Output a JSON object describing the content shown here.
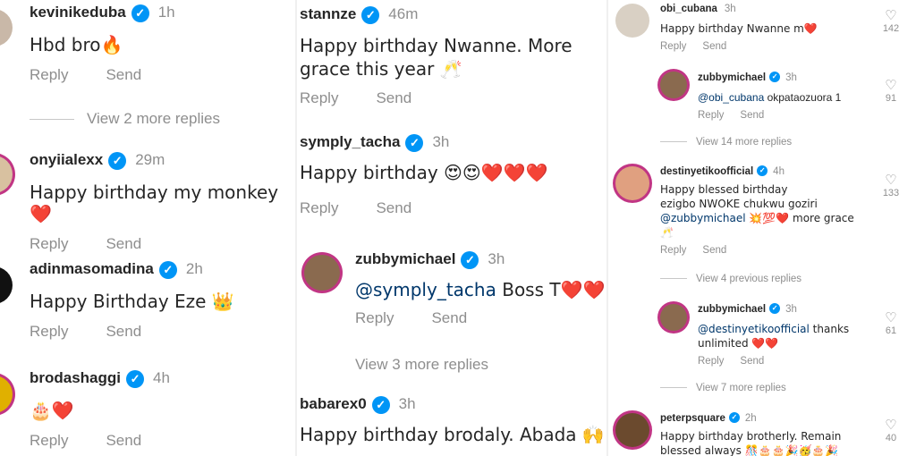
{
  "actions": {
    "reply": "Reply",
    "send": "Send"
  },
  "verified_glyph": "✓",
  "heart_glyph": "♡",
  "col1": {
    "comments": [
      {
        "username": "kevinikeduba",
        "time": "1h",
        "text": "Hbd bro🔥"
      },
      {
        "username": "onyiialexx",
        "time": "29m",
        "text": "Happy birthday my monkey ❤️"
      },
      {
        "username": "adinmasomadina",
        "time": "2h",
        "text": "Happy Birthday Eze 👑"
      },
      {
        "username": "brodashaggi",
        "time": "4h",
        "text": "🎂❤️"
      }
    ],
    "view_replies": "View 2 more replies"
  },
  "col2": {
    "comments": [
      {
        "username": "stannze",
        "time": "46m",
        "text": "Happy birthday Nwanne. More grace this year 🥂"
      },
      {
        "username": "symply_tacha",
        "time": "3h",
        "text": "Happy birthday 😍😍❤️❤️❤️"
      },
      {
        "username": "zubbymichael",
        "time": "3h",
        "mention": "@symply_tacha",
        "text": " Boss T❤️❤️"
      },
      {
        "username": "babarex0",
        "time": "3h",
        "text": "Happy birthday brodaly.  Abada 🙌"
      }
    ],
    "view_replies": "View 3 more replies"
  },
  "col3": {
    "comments": [
      {
        "username": "obi_cubana",
        "time": "3h",
        "text": "Happy birthday Nwanne m❤️",
        "likes": "142"
      },
      {
        "username": "zubbymichael",
        "time": "3h",
        "mention": "@obi_cubana",
        "text": " okpataozuora 1",
        "likes": "91"
      },
      {
        "username": "destinyetikoofficial",
        "time": "4h",
        "text_lines": [
          "Happy blessed birthday",
          "ezigbo NWOKE chukwu goziri"
        ],
        "mention": "@zubbymichael",
        "text_after": " 💥💯❤️ more grace",
        "text_last": "🥂",
        "likes": "133"
      },
      {
        "username": "zubbymichael",
        "time": "3h",
        "mention": "@destinyetikoofficial",
        "text": " thanks",
        "text2": "unlimited ❤️❤️",
        "likes": "61"
      },
      {
        "username": "peterpsquare",
        "time": "2h",
        "text": "Happy birthday brotherly. Remain",
        "text2": "blessed always 🎊🎂🎂🎉🥳🎂🎉",
        "likes": "40"
      }
    ],
    "view_14": "View 14 more replies",
    "view_prev_4": "View 4 previous replies",
    "view_7": "View 7 more replies"
  }
}
